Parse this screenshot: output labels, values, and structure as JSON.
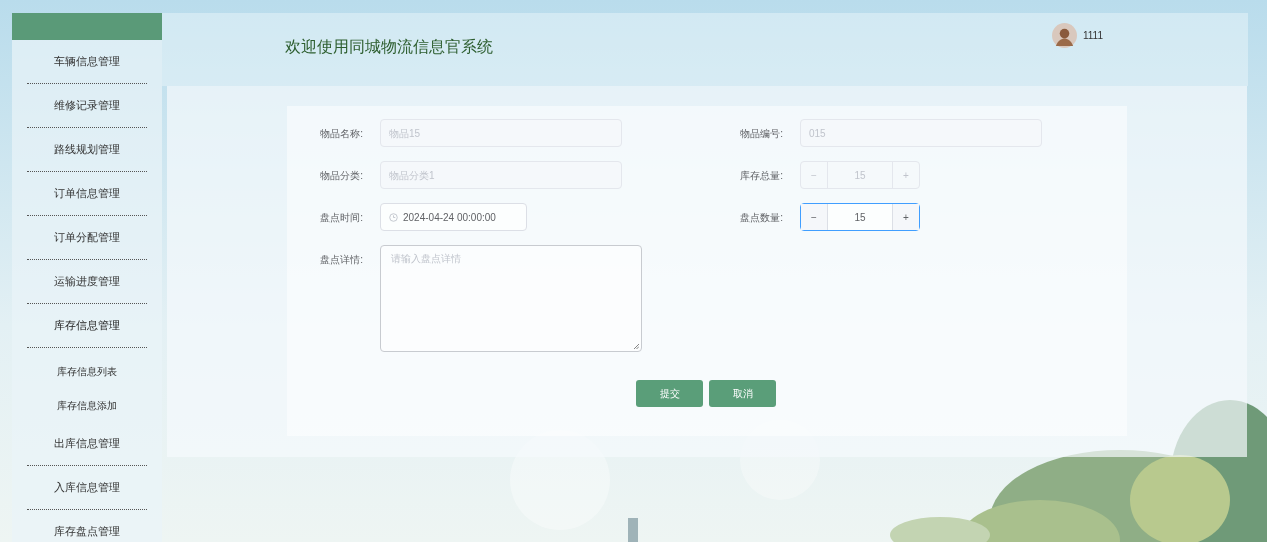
{
  "sidebar": {
    "items": [
      {
        "label": "车辆信息管理",
        "expanded": false
      },
      {
        "label": "维修记录管理",
        "expanded": false
      },
      {
        "label": "路线规划管理",
        "expanded": false
      },
      {
        "label": "订单信息管理",
        "expanded": false
      },
      {
        "label": "订单分配管理",
        "expanded": false
      },
      {
        "label": "运输进度管理",
        "expanded": false
      },
      {
        "label": "库存信息管理",
        "expanded": true,
        "children": [
          {
            "label": "库存信息列表"
          },
          {
            "label": "库存信息添加"
          }
        ]
      },
      {
        "label": "出库信息管理",
        "expanded": false
      },
      {
        "label": "入库信息管理",
        "expanded": false
      },
      {
        "label": "库存盘点管理",
        "expanded": false
      }
    ]
  },
  "header": {
    "title": "欢迎使用同城物流信息官系统",
    "username": "1111"
  },
  "form": {
    "fields": [
      {
        "kind": "text",
        "label": "物品名称:",
        "value": "物品15",
        "disabled": true
      },
      {
        "kind": "text",
        "label": "物品编号:",
        "value": "015",
        "disabled": true
      },
      {
        "kind": "text",
        "label": "物品分类:",
        "value": "物品分类1",
        "disabled": true
      },
      {
        "kind": "number",
        "label": "库存总量:",
        "value": "15",
        "minus": "−",
        "plus": "+",
        "disabled": true
      },
      {
        "kind": "date",
        "label": "盘点时间:",
        "value": "2024-04-24 00:00:00",
        "disabled": false
      },
      {
        "kind": "number",
        "label": "盘点数量:",
        "value": "15",
        "minus": "−",
        "plus": "+",
        "disabled": false
      },
      {
        "kind": "textarea",
        "label": "盘点详情:",
        "placeholder": "请输入盘点详情",
        "disabled": false
      }
    ],
    "buttons": [
      "提交",
      "取消"
    ]
  }
}
